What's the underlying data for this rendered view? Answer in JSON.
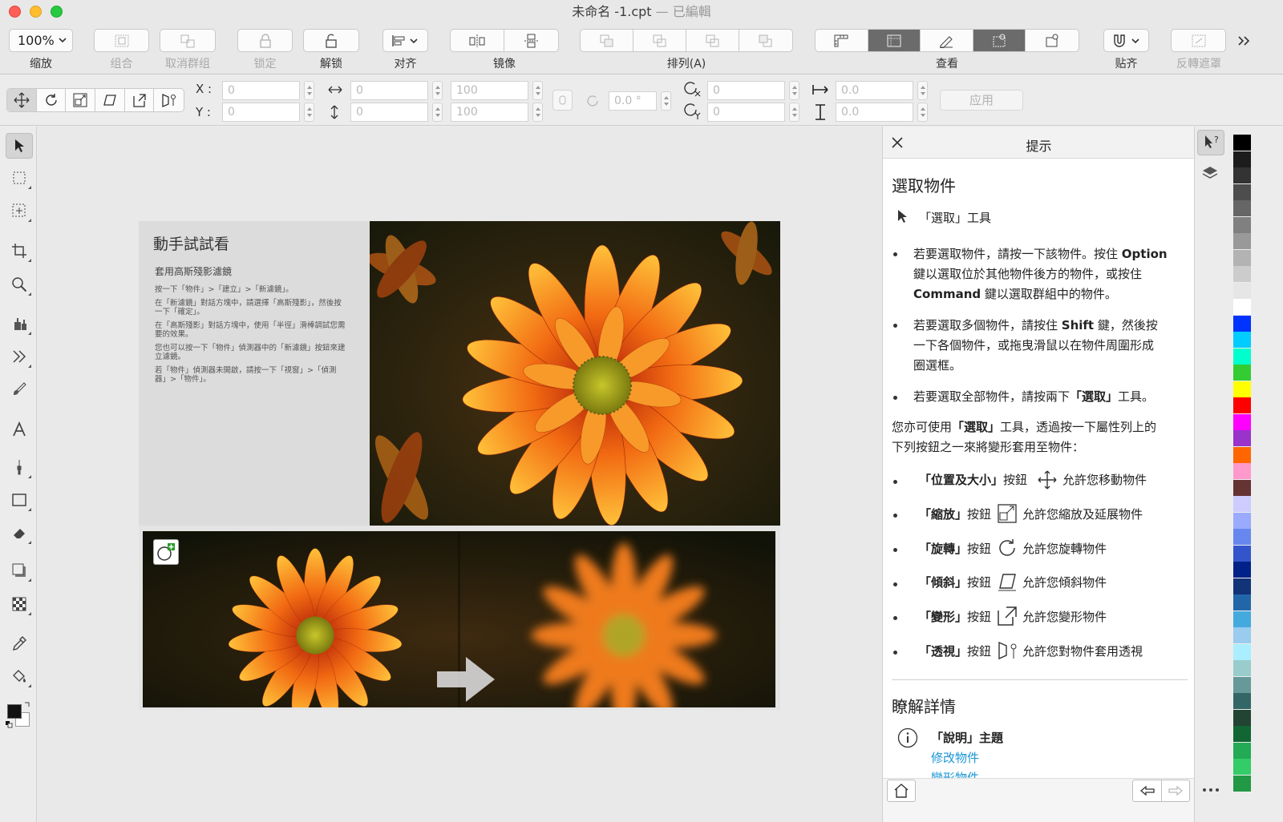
{
  "window": {
    "title": "未命名 -1.cpt",
    "edited": "— 已編輯"
  },
  "toolbar": {
    "zoom_value": "100%",
    "labels": {
      "zoom": "缩放",
      "group": "组合",
      "ungroup": "取消群组",
      "lock": "锁定",
      "unlock": "解锁",
      "align": "对齐",
      "mirror": "镜像",
      "arrange": "排列(A)",
      "view": "查看",
      "snap": "贴齐",
      "invert_mask": "反轉遮罩"
    }
  },
  "propbar": {
    "x_label": "X :",
    "y_label": "Y :",
    "x_value": "0",
    "y_value": "0",
    "width_value": "0",
    "height_value": "0",
    "scale_w": "100",
    "scale_h": "100",
    "angle": "0.0 °",
    "center_x": "0",
    "center_y": "0",
    "skew_h": "0.0",
    "skew_v": "0.0",
    "apply": "应用"
  },
  "doc": {
    "title": "動手試試看",
    "subtitle": "套用高斯殘影濾鏡",
    "steps": [
      "按一下「物件」>「建立」>「新濾鏡」。",
      "在「新濾鏡」對話方塊中，請選擇「高斯殘影」，然後按一下「確定」。",
      "在「高斯殘影」對話方塊中，使用「半徑」滑棒調試您需要的效果。",
      "您也可以按一下「物件」偵測器中的「新濾鏡」按鈕來建立濾鏡。",
      "若「物件」偵測器未開啟，請按一下「視窗」>「偵測器」>「物件」。"
    ]
  },
  "hints": {
    "panel_title": "提示",
    "heading": "選取物件",
    "tool_line": "「選取」工具",
    "bullets": [
      "若要選取物件，請按一下該物件。按住 Option 鍵以選取位於其他物件後方的物件，或按住 Command 鍵以選取群組中的物件。",
      "若要選取多個物件，請按住 Shift 鍵，然後按一下各個物件，或拖曳滑鼠以在物件周圍形成圈選框。",
      "若要選取全部物件，請按兩下「選取」工具。"
    ],
    "bullet1_a": "若要選取物件，請按一下該物件。按住 ",
    "bullet1_b": "Option",
    "bullet1_c": "鍵以選取位於其他物件後方的物件，或按住",
    "bullet1_d": "Command",
    "bullet1_e": " 鍵以選取群組中的物件。",
    "bullet2_a": "若要選取多個物件，請按住 ",
    "bullet2_b": "Shift",
    "bullet2_c": " 鍵，然後按",
    "bullet2_d": "一下各個物件，或拖曳滑鼠以在物件周圍形成",
    "bullet2_e": "圈選框。",
    "bullet3_a": "若要選取全部物件，請按兩下",
    "bullet3_b": "「選取」",
    "bullet3_c": "工具。",
    "para_a": "您亦可使用",
    "para_b": "「選取」",
    "para_c": "工具，透過按一下屬性列上的",
    "para_d": "下列按鈕之一來將變形套用至物件：",
    "rows": [
      {
        "name": "「位置及大小」",
        "suffix": "按鈕",
        "desc": "允許您移動物件"
      },
      {
        "name": "「縮放」",
        "suffix": "按鈕",
        "desc": "允許您縮放及延展物件"
      },
      {
        "name": "「旋轉」",
        "suffix": "按鈕",
        "desc": "允許您旋轉物件"
      },
      {
        "name": "「傾斜」",
        "suffix": "按鈕",
        "desc": "允許您傾斜物件"
      },
      {
        "name": "「變形」",
        "suffix": "按鈕",
        "desc": "允許您變形物件"
      },
      {
        "name": "「透視」",
        "suffix": "按鈕",
        "desc": "允許您對物件套用透視"
      }
    ],
    "learn_more": "瞭解詳情",
    "help_topic": "「說明」主題",
    "link1": "修改物件",
    "link2": "變形物件"
  },
  "palette_colors": [
    "#000000",
    "#1c1c1c",
    "#333333",
    "#4d4d4d",
    "#666666",
    "#808080",
    "#999999",
    "#b3b3b3",
    "#cccccc",
    "#e6e6e6",
    "#ffffff",
    "#0033ff",
    "#00ccff",
    "#00ffcc",
    "#33cc33",
    "#ffff00",
    "#ff0000",
    "#ff00ff",
    "#9933cc",
    "#ff6600",
    "#ff99cc",
    "#663333",
    "#ccccff",
    "#99aaff",
    "#6688ee",
    "#3355cc",
    "#002288",
    "#113377",
    "#2266aa",
    "#44aadd",
    "#99ccee",
    "#aaeeff",
    "#99cccc",
    "#669999",
    "#336666",
    "#224433",
    "#116633",
    "#22aa55",
    "#33cc66",
    "#229944"
  ]
}
